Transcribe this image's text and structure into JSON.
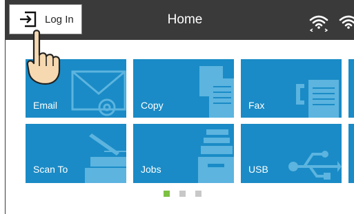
{
  "header": {
    "login_label": "Log In",
    "title": "Home",
    "icons": [
      "login-arrow-icon",
      "wifi-icon",
      "wifi-icon"
    ]
  },
  "tiles": [
    {
      "label": "Email",
      "icon": "envelope-icon"
    },
    {
      "label": "Copy",
      "icon": "documents-icon"
    },
    {
      "label": "Fax",
      "icon": "fax-phone-icon"
    },
    {
      "label": "Scan To",
      "icon": "scanner-icon"
    },
    {
      "label": "Jobs",
      "icon": "tray-stack-icon"
    },
    {
      "label": "USB",
      "icon": "usb-icon"
    }
  ],
  "pagination": {
    "pages": 3,
    "current": 1
  },
  "colors": {
    "topbar": "#3a3a3a",
    "tile": "#1a8bc6",
    "active_dot": "#7cc142",
    "inactive_dot": "#c8c8c8"
  }
}
